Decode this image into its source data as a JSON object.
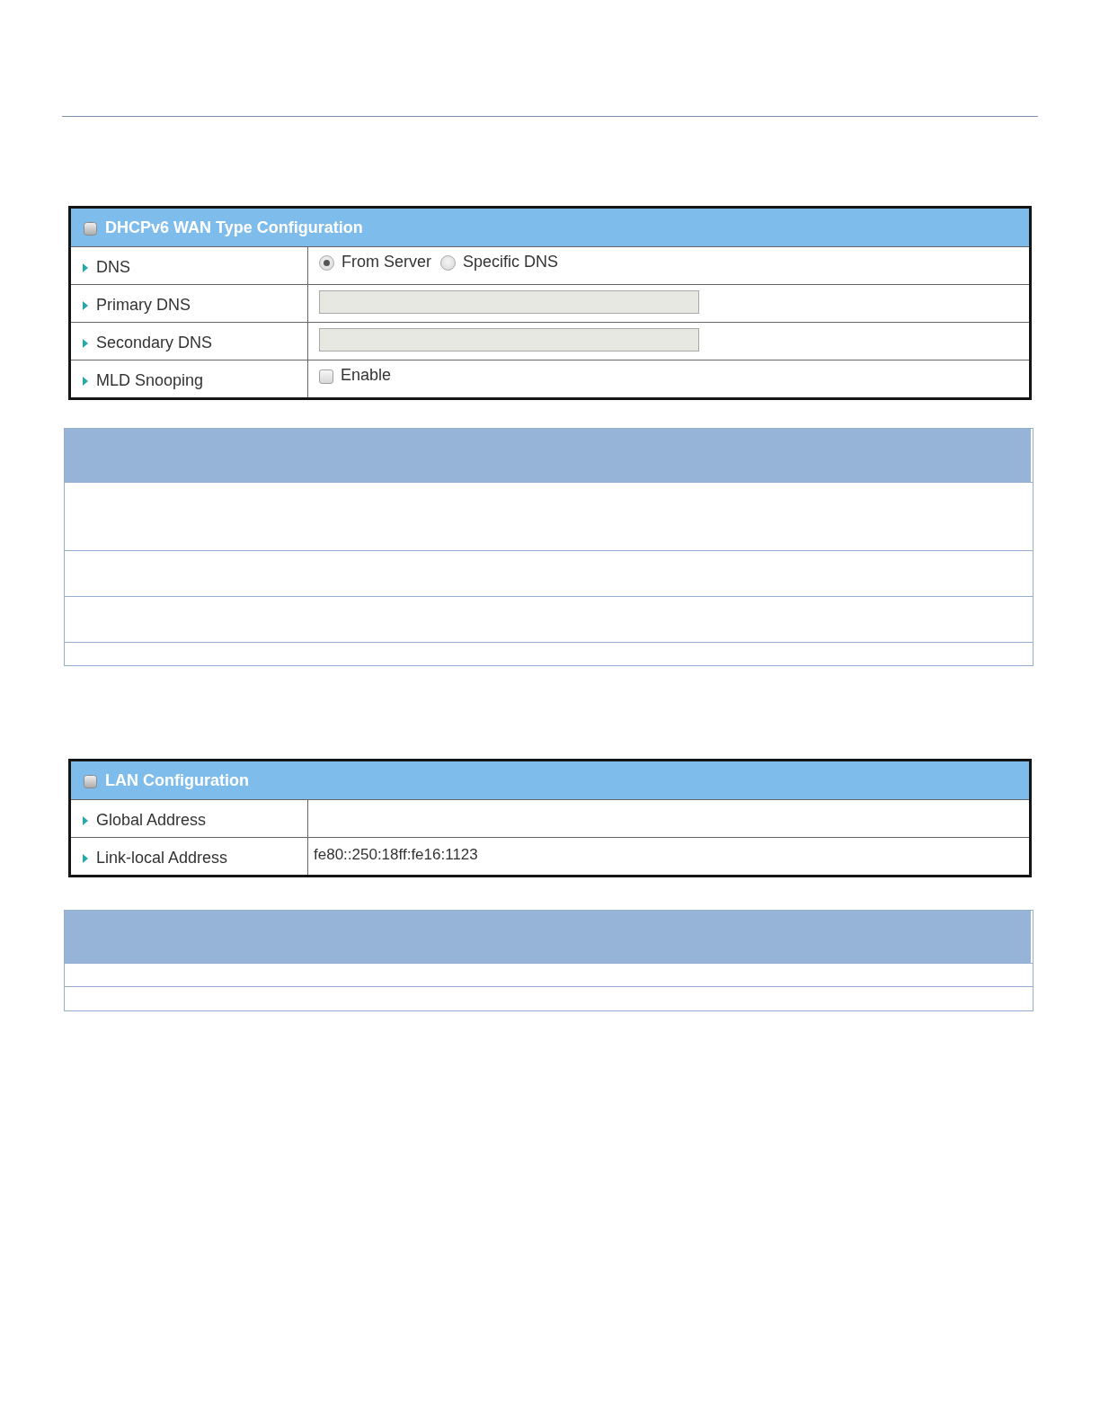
{
  "wan_panel": {
    "title": "DHCPv6 WAN Type Configuration",
    "rows": [
      {
        "label": "DNS",
        "kind": "radio_group",
        "options": [
          {
            "label": "From Server",
            "selected": true
          },
          {
            "label": "Specific DNS",
            "selected": false
          }
        ]
      },
      {
        "label": "Primary DNS",
        "kind": "text_field",
        "disabled": true
      },
      {
        "label": "Secondary DNS",
        "kind": "text_field",
        "disabled": true
      },
      {
        "label": "MLD Snooping",
        "kind": "checkbox",
        "checked": false,
        "option": "Enable"
      }
    ]
  },
  "lan_panel": {
    "title": "LAN Configuration",
    "rows": [
      {
        "label": "Global Address",
        "kind": "text"
      },
      {
        "label": "Link-local Address",
        "kind": "text",
        "value": "fe80::250:18ff:fe16:1123"
      }
    ]
  }
}
